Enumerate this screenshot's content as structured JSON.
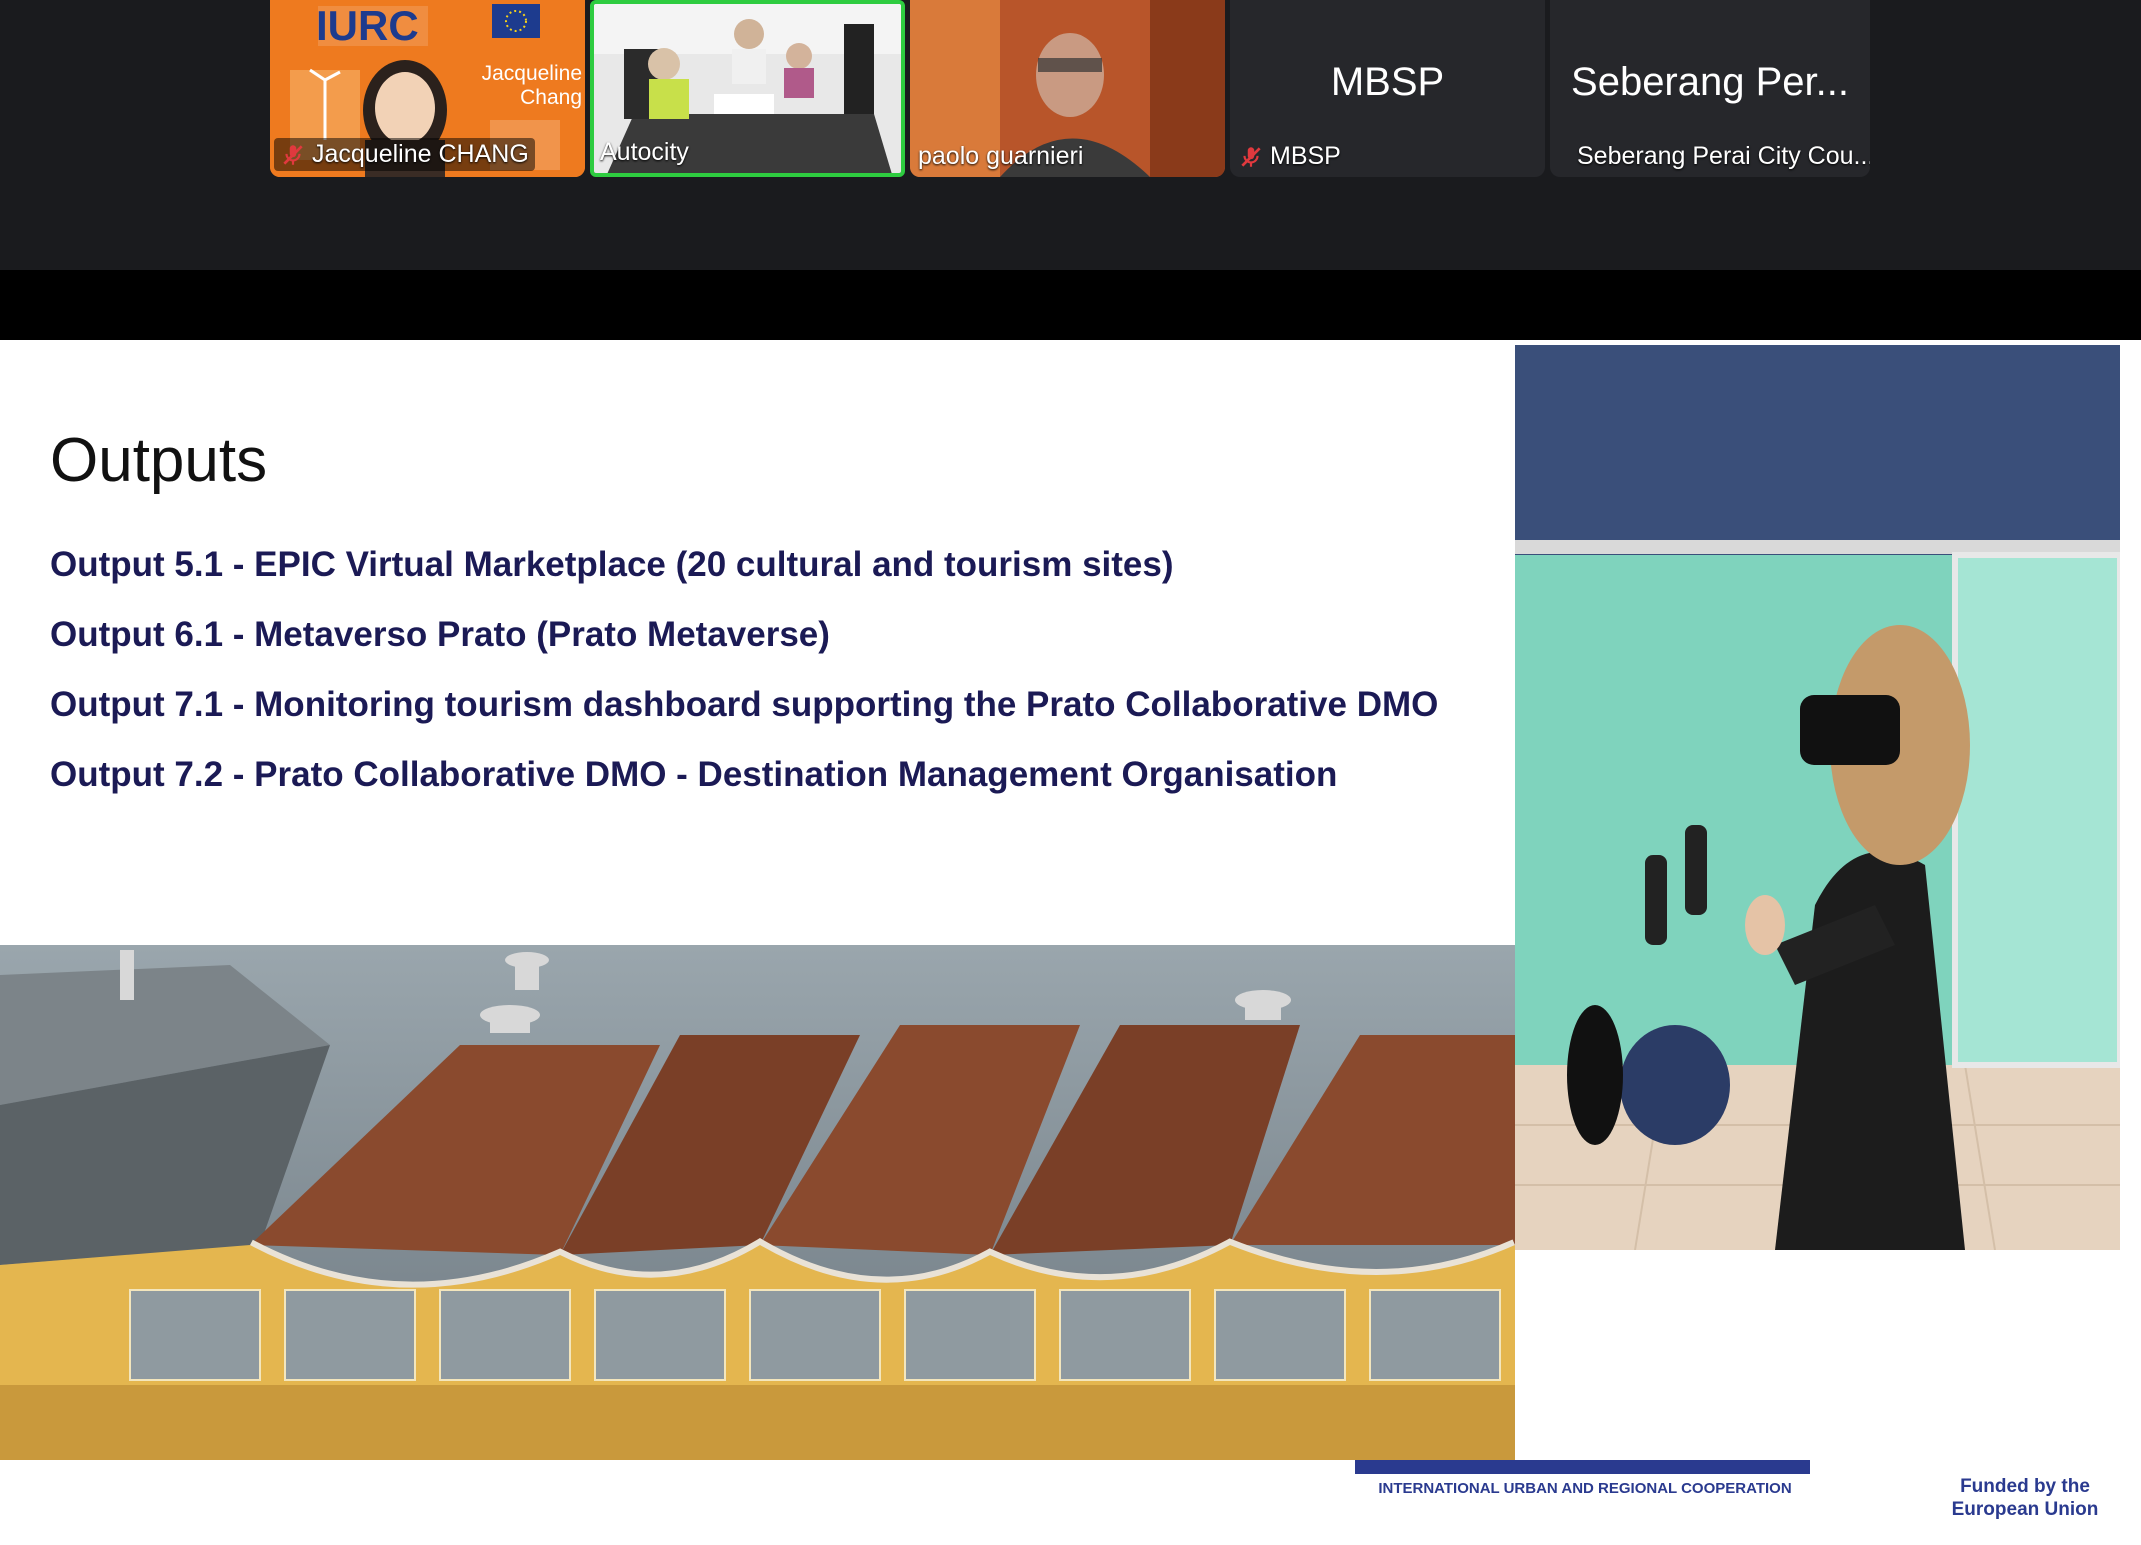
{
  "participants": [
    {
      "name": "Jacqueline CHANG",
      "muted": true,
      "tile_label": "Jacqueline Chang",
      "logo_text": "IURC"
    },
    {
      "name": "Autocity",
      "muted": false,
      "active_speaker": true
    },
    {
      "name": "paolo guarnieri",
      "muted": false
    },
    {
      "name": "MBSP",
      "muted": true,
      "display": "MBSP"
    },
    {
      "name": "Seberang Perai City Cou...",
      "muted": false,
      "display": "Seberang Per..."
    }
  ],
  "slide": {
    "title": "Outputs",
    "outputs": [
      "Output 5.1 - EPIC Virtual Marketplace (20 cultural and tourism sites)",
      "Output 6.1 - Metaverso Prato (Prato Metaverse)",
      "Output 7.1 - Monitoring tourism dashboard supporting the Prato Collaborative DMO",
      "Output 7.2 - Prato Collaborative DMO - Destination Management Organisation"
    ],
    "footer": {
      "iurc_caption": "INTERNATIONAL URBAN AND REGIONAL COOPERATION",
      "eu_line1": "Funded by the",
      "eu_line2": "European Union"
    }
  },
  "colors": {
    "accent_navy": "#1b1a55",
    "active_speaker_border": "#2ecc40",
    "mute_red": "#e0393e",
    "app_bg": "#1a1b1e"
  }
}
